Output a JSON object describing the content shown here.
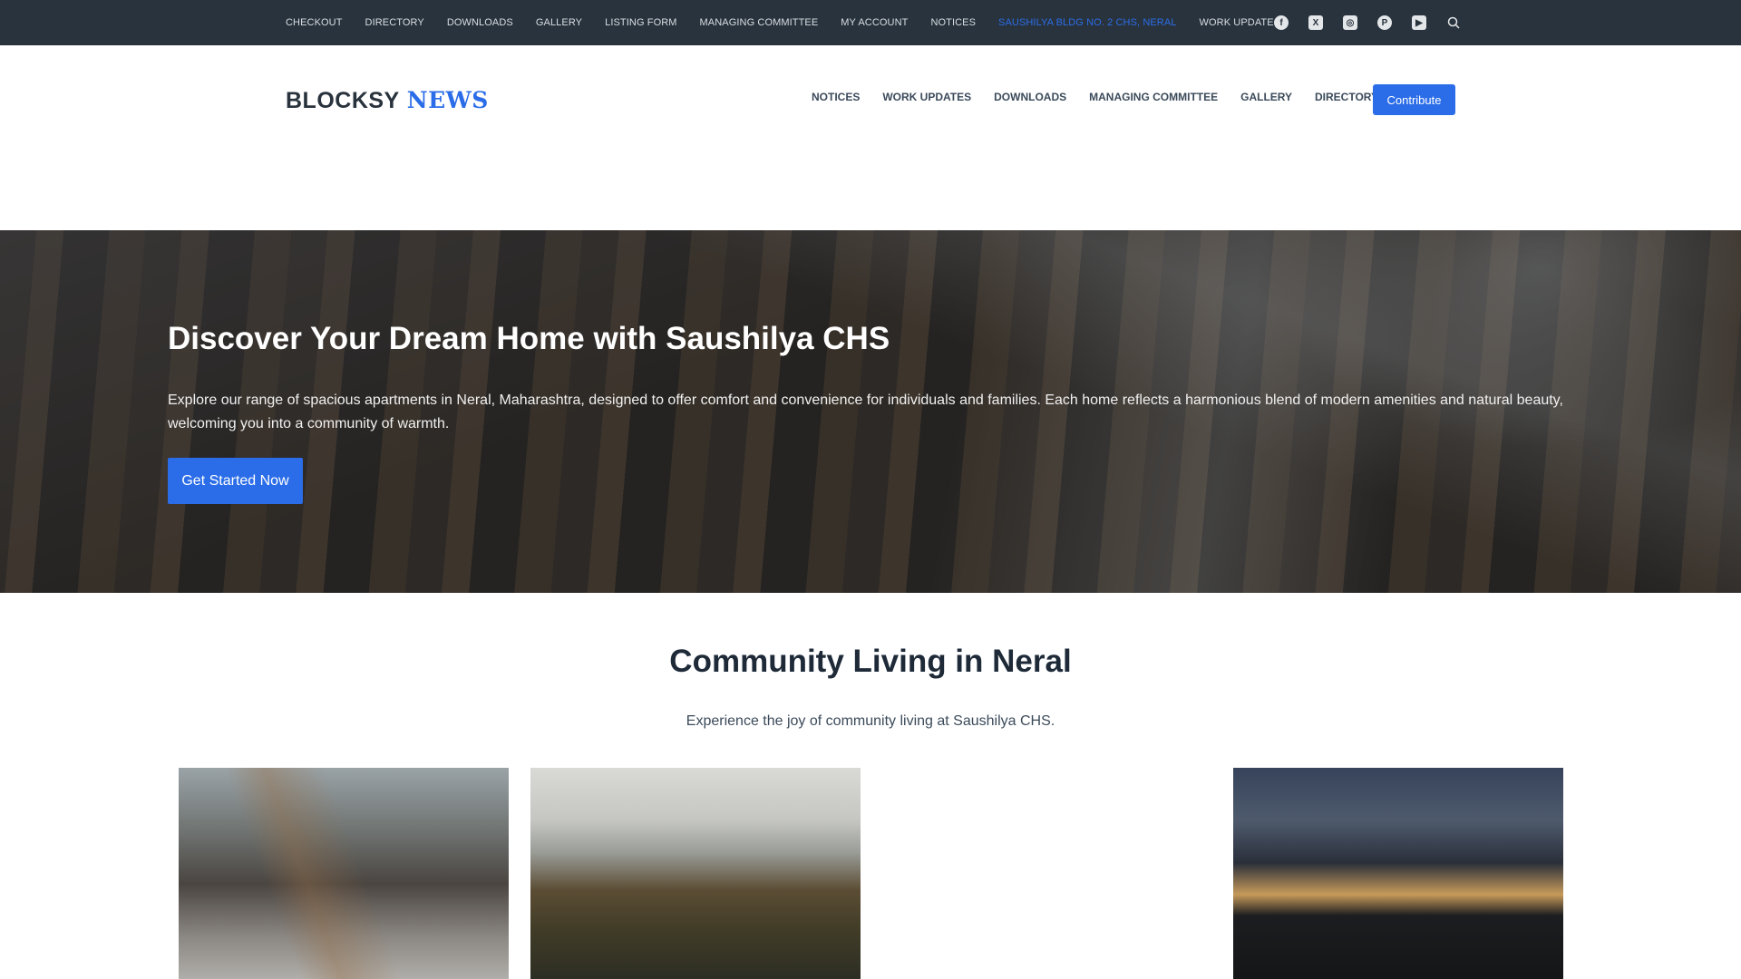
{
  "topbar": {
    "nav": [
      "CHECKOUT",
      "DIRECTORY",
      "DOWNLOADS",
      "GALLERY",
      "LISTING FORM",
      "MANAGING COMMITTEE",
      "MY ACCOUNT",
      "NOTICES",
      "SAUSHILYA BLDG NO. 2 CHS, NERAL",
      "WORK UPDATES"
    ],
    "active_index": 8,
    "social": [
      "facebook-icon",
      "x-icon",
      "instagram-icon",
      "pinterest-icon",
      "youtube-icon",
      "search-icon"
    ]
  },
  "header": {
    "logo_a": "BLOCKSY",
    "logo_b": "NEWS",
    "nav": [
      "NOTICES",
      "WORK UPDATES",
      "DOWNLOADS",
      "MANAGING COMMITTEE",
      "GALLERY",
      "DIRECTORY"
    ],
    "cta": "Contribute"
  },
  "hero": {
    "title": "Discover Your Dream Home with Saushilya CHS",
    "text": "Explore our range of spacious apartments in Neral, Maharashtra, designed to offer comfort and convenience for individuals and families. Each home reflects a harmonious blend of modern amenities and natural beauty, welcoming you into a community of warmth.",
    "button": "Get Started Now"
  },
  "section": {
    "title": "Community Living in Neral",
    "subtitle": "Experience the joy of community living at Saushilya CHS."
  },
  "colors": {
    "accent": "#2b6de8",
    "topbar": "#29333d"
  }
}
